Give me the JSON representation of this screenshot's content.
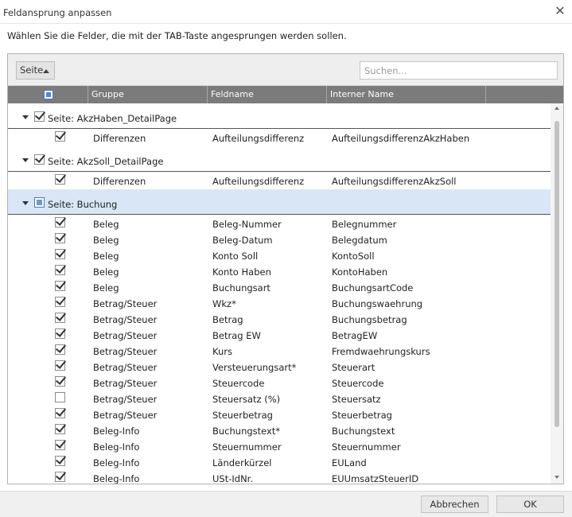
{
  "window": {
    "title": "Feldansprung anpassen",
    "close_glyph": "✕"
  },
  "instruction": "Wählen Sie die Felder, die mit der TAB-Taste angesprungen werden sollen.",
  "toolbar": {
    "group_button_label": "Seite",
    "search_placeholder": "Suchen..."
  },
  "columns": [
    "Gruppe",
    "Feldname",
    "Interner Name"
  ],
  "groups": [
    {
      "label": "Seite: AkzHaben_DetailPage",
      "state": "checked",
      "rows": [
        {
          "checked": true,
          "gruppe": "Differenzen",
          "feldname": "Aufteilungsdifferenz",
          "intern": "AufteilungsdifferenzAkzHaben"
        }
      ]
    },
    {
      "label": "Seite: AkzSoll_DetailPage",
      "state": "checked",
      "rows": [
        {
          "checked": true,
          "gruppe": "Differenzen",
          "feldname": "Aufteilungsdifferenz",
          "intern": "AufteilungsdifferenzAkzSoll"
        }
      ]
    },
    {
      "label": "Seite: Buchung",
      "state": "partial",
      "selected": true,
      "rows": [
        {
          "checked": true,
          "gruppe": "Beleg",
          "feldname": "Beleg-Nummer",
          "intern": "Belegnummer"
        },
        {
          "checked": true,
          "gruppe": "Beleg",
          "feldname": "Beleg-Datum",
          "intern": "Belegdatum"
        },
        {
          "checked": true,
          "gruppe": "Beleg",
          "feldname": "Konto Soll",
          "intern": "KontoSoll"
        },
        {
          "checked": true,
          "gruppe": "Beleg",
          "feldname": "Konto Haben",
          "intern": "KontoHaben"
        },
        {
          "checked": true,
          "gruppe": "Beleg",
          "feldname": "Buchungsart",
          "intern": "BuchungsartCode"
        },
        {
          "checked": true,
          "gruppe": "Betrag/Steuer",
          "feldname": "Wkz*",
          "intern": "Buchungswaehrung"
        },
        {
          "checked": true,
          "gruppe": "Betrag/Steuer",
          "feldname": "Betrag",
          "intern": "Buchungsbetrag"
        },
        {
          "checked": true,
          "gruppe": "Betrag/Steuer",
          "feldname": "Betrag EW",
          "intern": "BetragEW"
        },
        {
          "checked": true,
          "gruppe": "Betrag/Steuer",
          "feldname": "Kurs",
          "intern": "Fremdwaehrungskurs"
        },
        {
          "checked": true,
          "gruppe": "Betrag/Steuer",
          "feldname": "Versteuerungsart*",
          "intern": "Steuerart"
        },
        {
          "checked": true,
          "gruppe": "Betrag/Steuer",
          "feldname": "Steuercode",
          "intern": "Steuercode"
        },
        {
          "checked": false,
          "gruppe": "Betrag/Steuer",
          "feldname": "Steuersatz (%)",
          "intern": "Steuersatz"
        },
        {
          "checked": true,
          "gruppe": "Betrag/Steuer",
          "feldname": "Steuerbetrag",
          "intern": "Steuerbetrag"
        },
        {
          "checked": true,
          "gruppe": "Beleg-Info",
          "feldname": "Buchungstext*",
          "intern": "Buchungstext"
        },
        {
          "checked": true,
          "gruppe": "Beleg-Info",
          "feldname": "Steuernummer",
          "intern": "Steuernummer"
        },
        {
          "checked": true,
          "gruppe": "Beleg-Info",
          "feldname": "Länderkürzel",
          "intern": "EULand"
        },
        {
          "checked": true,
          "gruppe": "Beleg-Info",
          "feldname": "USt-IdNr.",
          "intern": "EUUmsatzSteuerID"
        }
      ]
    }
  ],
  "footer": {
    "cancel_label": "Abbrechen",
    "ok_label": "OK"
  },
  "colors": {
    "header_bg": "#7b7b7b",
    "selected_group_bg": "#d9e6f5",
    "accent": "#4a78c0"
  },
  "icons": {
    "close": "close-icon",
    "sort": "sort-ascending-icon",
    "expand": "chevron-down-icon"
  }
}
